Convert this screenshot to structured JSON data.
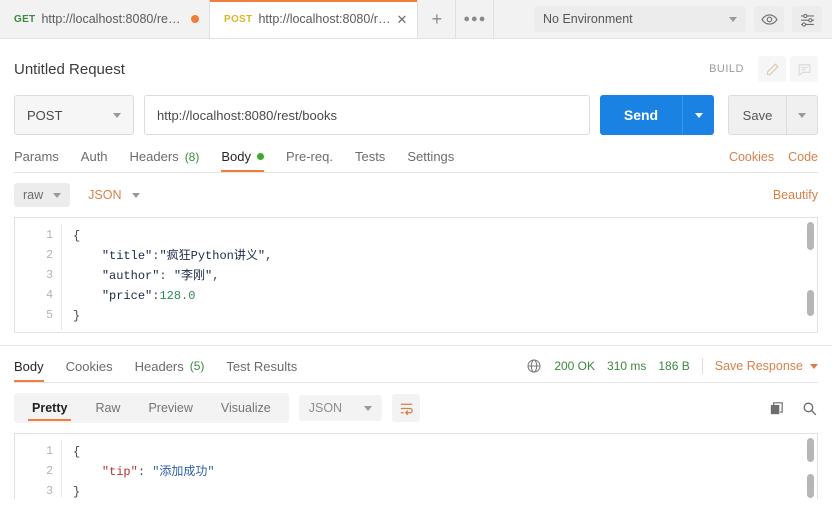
{
  "tabstrip": {
    "tabs": [
      {
        "verb": "GET",
        "label": "http://localhost:8080/res…",
        "state": "unsaved-dot",
        "active": false
      },
      {
        "verb": "POST",
        "label": "http://localhost:8080/r…",
        "state": "close",
        "active": true
      }
    ],
    "new_tab_label": "+",
    "more_label": "000",
    "environment": {
      "value": "No Environment"
    },
    "eye_icon": "eye-icon",
    "settings_icon": "sliders-icon"
  },
  "request": {
    "title": "Untitled Request",
    "build_label": "BUILD",
    "edit_icon": "pencil-icon",
    "comment_icon": "comment-icon",
    "method": "POST",
    "url": "http://localhost:8080/rest/books",
    "send_label": "Send",
    "save_label": "Save",
    "tabs": [
      {
        "label": "Params",
        "active": false
      },
      {
        "label": "Auth",
        "active": false
      },
      {
        "label": "Headers",
        "count": "(8)",
        "active": false
      },
      {
        "label": "Body",
        "dot": true,
        "active": true
      },
      {
        "label": "Pre-req.",
        "active": false
      },
      {
        "label": "Tests",
        "active": false
      },
      {
        "label": "Settings",
        "active": false
      }
    ],
    "cookies_link": "Cookies",
    "code_link": "Code",
    "body_mode": "raw",
    "body_format": "JSON",
    "beautify_link": "Beautify",
    "body_lines": [
      {
        "n": "1",
        "tokens": [
          {
            "t": "{",
            "c": "k-brace"
          }
        ]
      },
      {
        "n": "2",
        "tokens": [
          {
            "t": "    ",
            "c": "k-punc"
          },
          {
            "t": "\"title\"",
            "c": "k-key"
          },
          {
            "t": ":",
            "c": "k-punc"
          },
          {
            "t": "\"疯狂Python讲义\"",
            "c": "k-str"
          },
          {
            "t": ",",
            "c": "k-punc"
          }
        ]
      },
      {
        "n": "3",
        "tokens": [
          {
            "t": "    ",
            "c": "k-punc"
          },
          {
            "t": "\"author\"",
            "c": "k-key"
          },
          {
            "t": ": ",
            "c": "k-punc"
          },
          {
            "t": "\"李刚\"",
            "c": "k-str"
          },
          {
            "t": ",",
            "c": "k-punc"
          }
        ]
      },
      {
        "n": "4",
        "tokens": [
          {
            "t": "    ",
            "c": "k-punc"
          },
          {
            "t": "\"price\"",
            "c": "k-key"
          },
          {
            "t": ":",
            "c": "k-punc"
          },
          {
            "t": "128.0",
            "c": "k-num"
          }
        ]
      },
      {
        "n": "5",
        "tokens": [
          {
            "t": "}",
            "c": "k-brace"
          }
        ]
      }
    ]
  },
  "response": {
    "tabs": [
      {
        "label": "Body",
        "active": true
      },
      {
        "label": "Cookies",
        "active": false
      },
      {
        "label": "Headers",
        "count": "(5)",
        "active": false
      },
      {
        "label": "Test Results",
        "active": false
      }
    ],
    "globe_icon": "globe-icon",
    "status": "200 OK",
    "time": "310 ms",
    "size": "186 B",
    "save_response": "Save Response",
    "views": [
      {
        "label": "Pretty",
        "active": true
      },
      {
        "label": "Raw",
        "active": false
      },
      {
        "label": "Preview",
        "active": false
      },
      {
        "label": "Visualize",
        "active": false
      }
    ],
    "format": "JSON",
    "wrap_icon": "word-wrap-icon",
    "copy_icon": "copy-icon",
    "search_icon": "search-icon",
    "body_lines": [
      {
        "n": "1",
        "tokens": [
          {
            "t": "{",
            "c": "k-brace"
          }
        ]
      },
      {
        "n": "2",
        "tokens": [
          {
            "t": "    ",
            "c": "k-punc"
          },
          {
            "t": "\"tip\"",
            "c": "k-key-red"
          },
          {
            "t": ": ",
            "c": "k-punc"
          },
          {
            "t": "\"添加成功\"",
            "c": "k-str-blue"
          }
        ]
      },
      {
        "n": "3",
        "tokens": [
          {
            "t": "}",
            "c": "k-brace"
          }
        ]
      }
    ]
  },
  "colors": {
    "accent_orange": "#ef7f3d",
    "send_blue": "#1a82e2",
    "status_green": "#3c8a3c",
    "link_orange": "#d9804a"
  }
}
